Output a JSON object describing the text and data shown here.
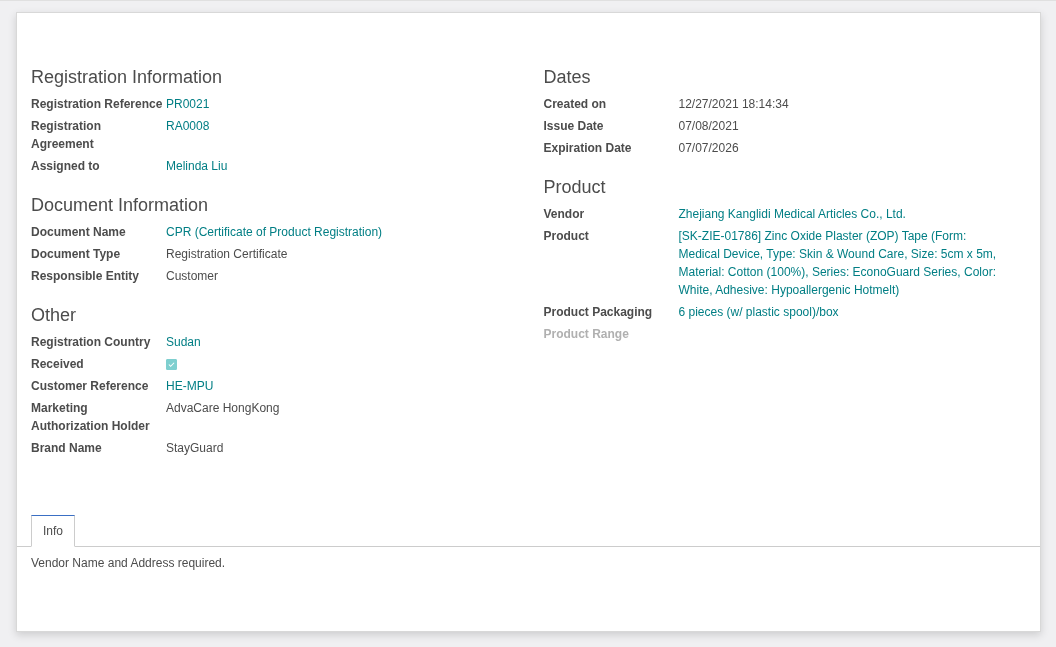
{
  "columns": [
    {
      "sections": [
        {
          "title": "Registration Information",
          "fields": [
            {
              "label": "Registration Reference",
              "kind": "link",
              "value": "PR0021",
              "muted": false
            },
            {
              "label": "Registration Agreement",
              "kind": "link",
              "value": "RA0008",
              "muted": false
            },
            {
              "label": "Assigned to",
              "kind": "link",
              "value": "Melinda Liu",
              "muted": false
            }
          ]
        },
        {
          "title": "Document Information",
          "fields": [
            {
              "label": "Document Name",
              "kind": "link",
              "value": "CPR (Certificate of Product Registration)",
              "muted": false
            },
            {
              "label": "Document Type",
              "kind": "text",
              "value": "Registration Certificate",
              "muted": false
            },
            {
              "label": "Responsible Entity",
              "kind": "text",
              "value": "Customer",
              "muted": false
            }
          ]
        },
        {
          "title": "Other",
          "fields": [
            {
              "label": "Registration Country",
              "kind": "link",
              "value": "Sudan",
              "muted": false
            },
            {
              "label": "Received",
              "kind": "checkbox",
              "checked": true,
              "muted": false
            },
            {
              "label": "Customer Reference",
              "kind": "link",
              "value": "HE-MPU",
              "muted": false
            },
            {
              "label": "Marketing Authorization Holder",
              "kind": "text",
              "value": "AdvaCare HongKong",
              "muted": false
            },
            {
              "label": "Brand Name",
              "kind": "text",
              "value": "StayGuard",
              "muted": false
            }
          ]
        }
      ]
    },
    {
      "sections": [
        {
          "title": "Dates",
          "fields": [
            {
              "label": "Created on",
              "kind": "text",
              "value": "12/27/2021 18:14:34",
              "muted": false
            },
            {
              "label": "Issue Date",
              "kind": "text",
              "value": "07/08/2021",
              "muted": false
            },
            {
              "label": "Expiration Date",
              "kind": "text",
              "value": "07/07/2026",
              "muted": false
            }
          ]
        },
        {
          "title": "Product",
          "fields": [
            {
              "label": "Vendor",
              "kind": "link",
              "value": "Zhejiang Kanglidi Medical Articles Co., Ltd.",
              "muted": false
            },
            {
              "label": "Product",
              "kind": "link",
              "value": "[SK-ZIE-01786] Zinc Oxide Plaster (ZOP) Tape (Form: Medical Device, Type: Skin & Wound Care, Size: 5cm x 5m, Material: Cotton (100%), Series: EconoGuard Series, Color: White, Adhesive: Hypoallergenic Hotmelt)",
              "muted": false
            },
            {
              "label": "Product Packaging",
              "kind": "link",
              "value": "6 pieces (w/ plastic spool)/box",
              "muted": false
            },
            {
              "label": "Product Range",
              "kind": "empty",
              "muted": true
            }
          ]
        }
      ]
    }
  ],
  "tabs": [
    {
      "label": "Info",
      "selected": true
    }
  ],
  "tab_content": "Vendor Name and Address required."
}
